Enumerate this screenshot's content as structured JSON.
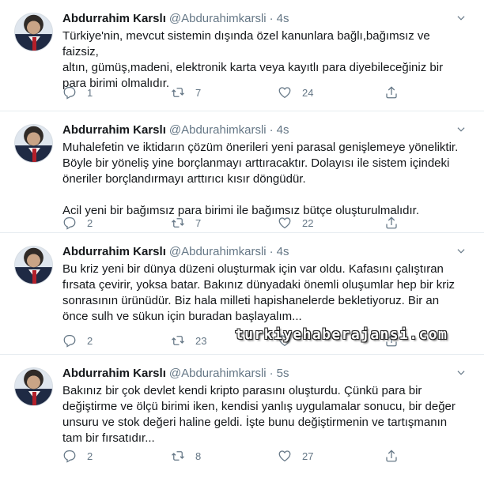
{
  "tweets": [
    {
      "name": "Abdurrahim Karslı",
      "handle": "@Abdurahimkarsli",
      "time": "4s",
      "text": "Türkiye'nin, mevcut sistemin dışında özel kanunlara bağlı,bağımsız ve faizsiz,\naltın, gümüş,madeni, elektronik karta veya kayıtlı para diyebileceğiniz bir\npara birimi olmalıdır.",
      "replies": "1",
      "retweets": "7",
      "likes": "24"
    },
    {
      "name": "Abdurrahim Karslı",
      "handle": "@Abdurahimkarsli",
      "time": "4s",
      "text": "Muhalefetin ve iktidarın çözüm önerileri yeni parasal genişlemeye yöneliktir.\nBöyle bir yöneliş yine borçlanmayı arttıracaktır. Dolayısı ile sistem içindeki\nöneriler borçlandırmayı arttırıcı kısır döngüdür.\n\nAcil yeni bir bağımsız para birimi ile bağımsız bütçe oluşturulmalıdır.",
      "replies": "2",
      "retweets": "7",
      "likes": "22"
    },
    {
      "name": "Abdurrahim Karslı",
      "handle": "@Abdurahimkarsli",
      "time": "4s",
      "text": "Bu kriz yeni bir dünya düzeni oluşturmak için var oldu. Kafasını çalıştıran\nfırsata çevirir, yoksa batar. Bakınız dünyadaki önemli oluşumlar hep bir kriz\nsonrasının ürünüdür.  Biz hala milleti hapishanelerde bekletiyoruz. Bir an\nönce sulh ve sükun için buradan başlayalım...",
      "replies": "2",
      "retweets": "23",
      "likes": ""
    },
    {
      "name": "Abdurrahim Karslı",
      "handle": "@Abdurahimkarsli",
      "time": "5s",
      "text": "Bakınız bir çok devlet kendi kripto parasını oluşturdu. Çünkü para bir\ndeğiştirme ve ölçü birimi iken, kendisi yanlış uygulamalar sonucu, bir değer\nunsuru ve stok değeri haline geldi. İşte bunu değiştirmenin ve tartışmanın\ntam bir fırsatıdır...",
      "replies": "2",
      "retweets": "8",
      "likes": "27"
    }
  ],
  "separator": "·",
  "watermark": "turkiyehaberajansi.com",
  "icons": {
    "reply": "reply-icon",
    "retweet": "retweet-icon",
    "like": "heart-icon",
    "share": "share-icon",
    "menu": "chevron-down-icon"
  },
  "colors": {
    "text": "#14171a",
    "muted": "#657786",
    "divider": "#e6ecf0"
  }
}
